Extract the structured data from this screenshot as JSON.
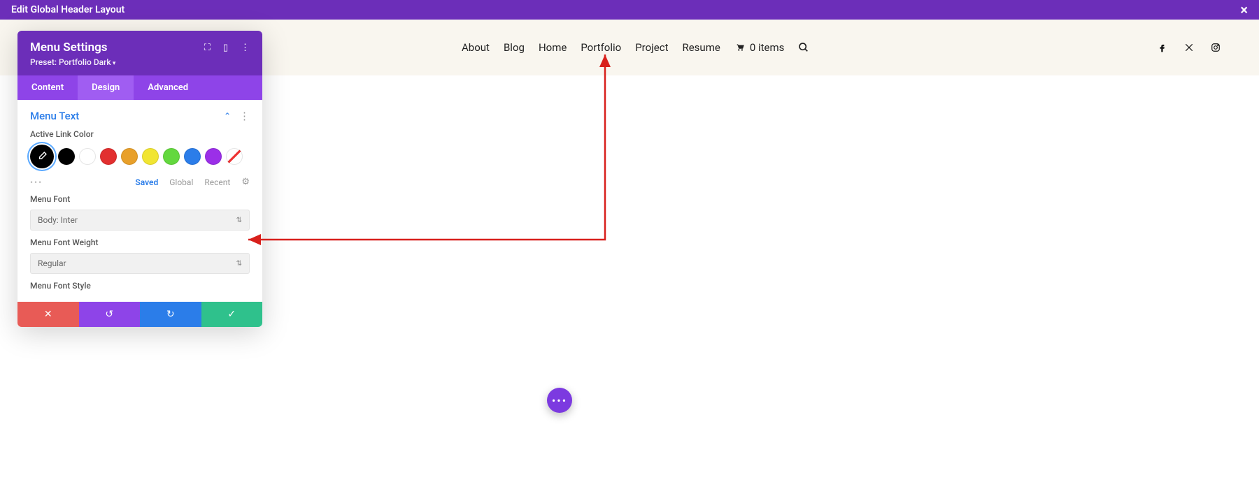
{
  "topbar": {
    "title": "Edit Global Header Layout"
  },
  "nav": {
    "items": [
      "About",
      "Blog",
      "Home",
      "Portfolio",
      "Project",
      "Resume"
    ],
    "cart_label": "0 items"
  },
  "panel": {
    "title": "Menu Settings",
    "preset": "Preset: Portfolio Dark",
    "tabs": {
      "content": "Content",
      "design": "Design",
      "advanced": "Advanced"
    },
    "section": "Menu Text",
    "labels": {
      "active_link_color": "Active Link Color",
      "menu_font": "Menu Font",
      "menu_font_weight": "Menu Font Weight",
      "menu_font_style": "Menu Font Style"
    },
    "palette_tabs": {
      "saved": "Saved",
      "global": "Global",
      "recent": "Recent"
    },
    "swatch_colors": [
      "#000000",
      "#ffffff",
      "#e22f2f",
      "#e8a02a",
      "#f1e532",
      "#63d83e",
      "#2b7de9",
      "#9b2fe8"
    ],
    "selects": {
      "font": "Body: Inter",
      "weight": "Regular"
    }
  }
}
